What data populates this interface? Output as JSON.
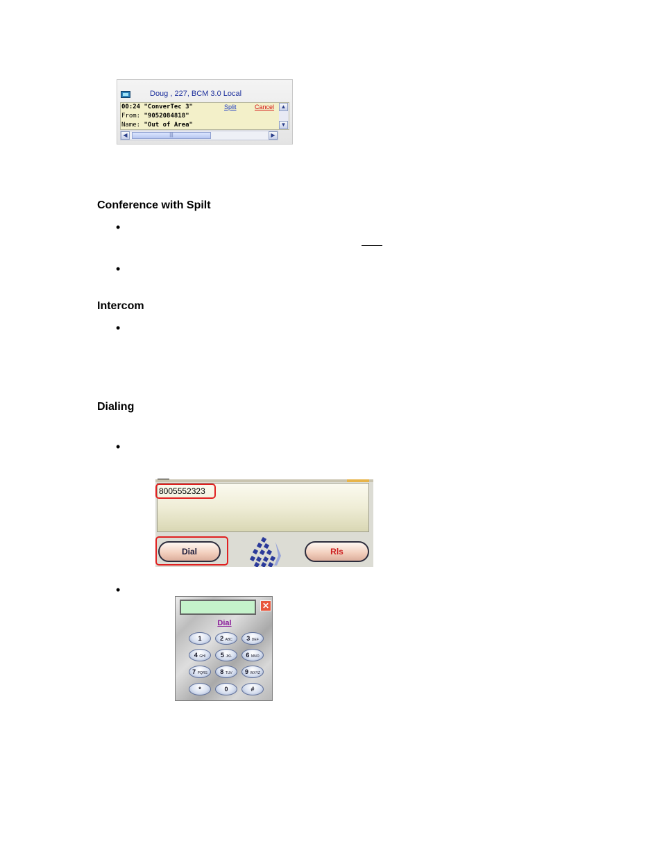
{
  "call_widget": {
    "title": "Doug , 227, BCM 3.0 Local",
    "line1": "00:24 \"ConverTec 3\"",
    "from_label": "From:",
    "from_value": "\"9052084818\"",
    "name_label": "Name:",
    "name_value": "\"Out of Area\"",
    "split_link": "Split",
    "cancel_link": "Cancel",
    "thumb_grip": "|||"
  },
  "sections": [
    {
      "heading": "Conference with Spilt"
    },
    {
      "heading": "Intercom"
    },
    {
      "heading": "Dialing"
    }
  ],
  "bullet_glyph": "•",
  "dialer": {
    "number": "8005552323",
    "dial_label": "Dial",
    "release_label": "Rls"
  },
  "keypad": {
    "close_glyph": "✕",
    "dial_link": "Dial",
    "keys": [
      {
        "digit": "1",
        "letters": ""
      },
      {
        "digit": "2",
        "letters": "ABC"
      },
      {
        "digit": "3",
        "letters": "DEF"
      },
      {
        "digit": "4",
        "letters": "GHI"
      },
      {
        "digit": "5",
        "letters": "JKL"
      },
      {
        "digit": "6",
        "letters": "MNO"
      },
      {
        "digit": "7",
        "letters": "PQRS"
      },
      {
        "digit": "8",
        "letters": "TUV"
      },
      {
        "digit": "9",
        "letters": "WXYZ"
      },
      {
        "digit": "*",
        "letters": ""
      },
      {
        "digit": "0",
        "letters": ""
      },
      {
        "digit": "#",
        "letters": ""
      }
    ]
  },
  "colors": {
    "title_blue": "#1c2f9c",
    "split_blue": "#1a39c5",
    "cancel_red": "#d41010",
    "highlight_red": "#e02020",
    "keypad_input_green": "#c5f3cb",
    "dial_link_purple": "#8a1a9a"
  }
}
